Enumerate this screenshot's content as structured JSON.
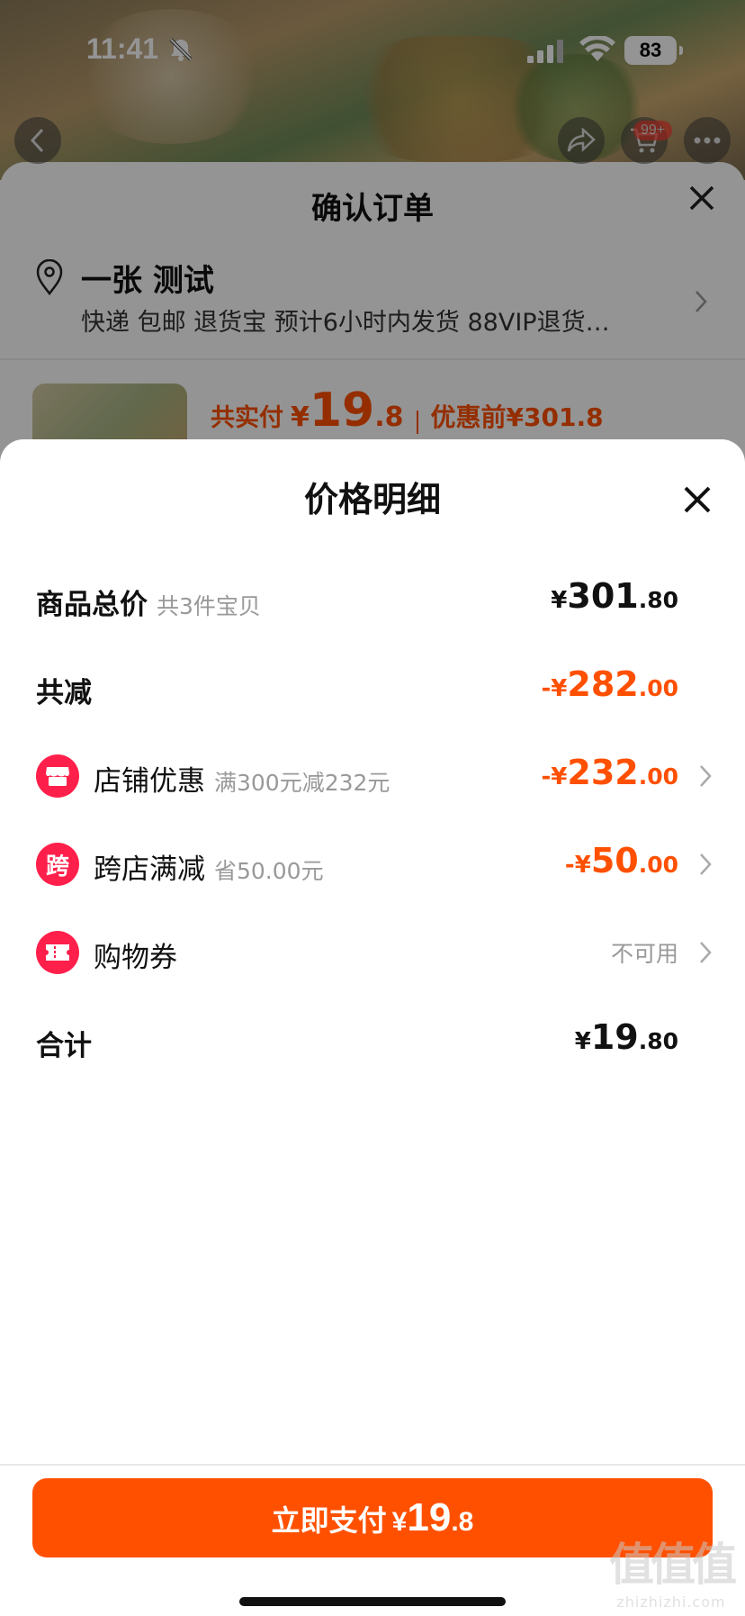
{
  "status_bar": {
    "time": "11:41",
    "battery": "83"
  },
  "top_nav": {
    "cart_badge": "99+"
  },
  "order_sheet": {
    "title": "确认订单",
    "address_name": "一张 测试",
    "address_detail": "快递 包邮 退货宝 预计6小时内发货 88VIP退货…",
    "summary_label": "共实付",
    "summary_currency": "¥",
    "summary_int": "19",
    "summary_dec": ".8",
    "summary_before": "优惠前¥301.8"
  },
  "price_detail": {
    "title": "价格明细",
    "rows": [
      {
        "label": "商品总价",
        "sub": "共3件宝贝",
        "cur": "¥",
        "int": "301",
        "dec": ".80"
      },
      {
        "label": "共减",
        "sub": "",
        "cur": "-¥",
        "int": "282",
        "dec": ".00"
      },
      {
        "label": "店铺优惠",
        "sub": "满300元减232元",
        "cur": "-¥",
        "int": "232",
        "dec": ".00",
        "icon": "shop-icon"
      },
      {
        "label": "跨店满减",
        "sub": "省50.00元",
        "cur": "-¥",
        "int": "50",
        "dec": ".00",
        "icon_text": "跨"
      },
      {
        "label": "购物券",
        "sub": "",
        "value_text": "不可用",
        "icon": "coupon-icon"
      },
      {
        "label": "合计",
        "sub": "",
        "cur": "¥",
        "int": "19",
        "dec": ".80"
      }
    ]
  },
  "pay_button": {
    "label": "立即支付",
    "cur": "¥",
    "int": "19",
    "dec": ".8"
  },
  "watermark": {
    "main": "值值值",
    "sub": "zhizhizhi.com"
  },
  "colors": {
    "accent": "#ff5000",
    "icon_red": "#ff1f4b",
    "muted": "#999999"
  }
}
